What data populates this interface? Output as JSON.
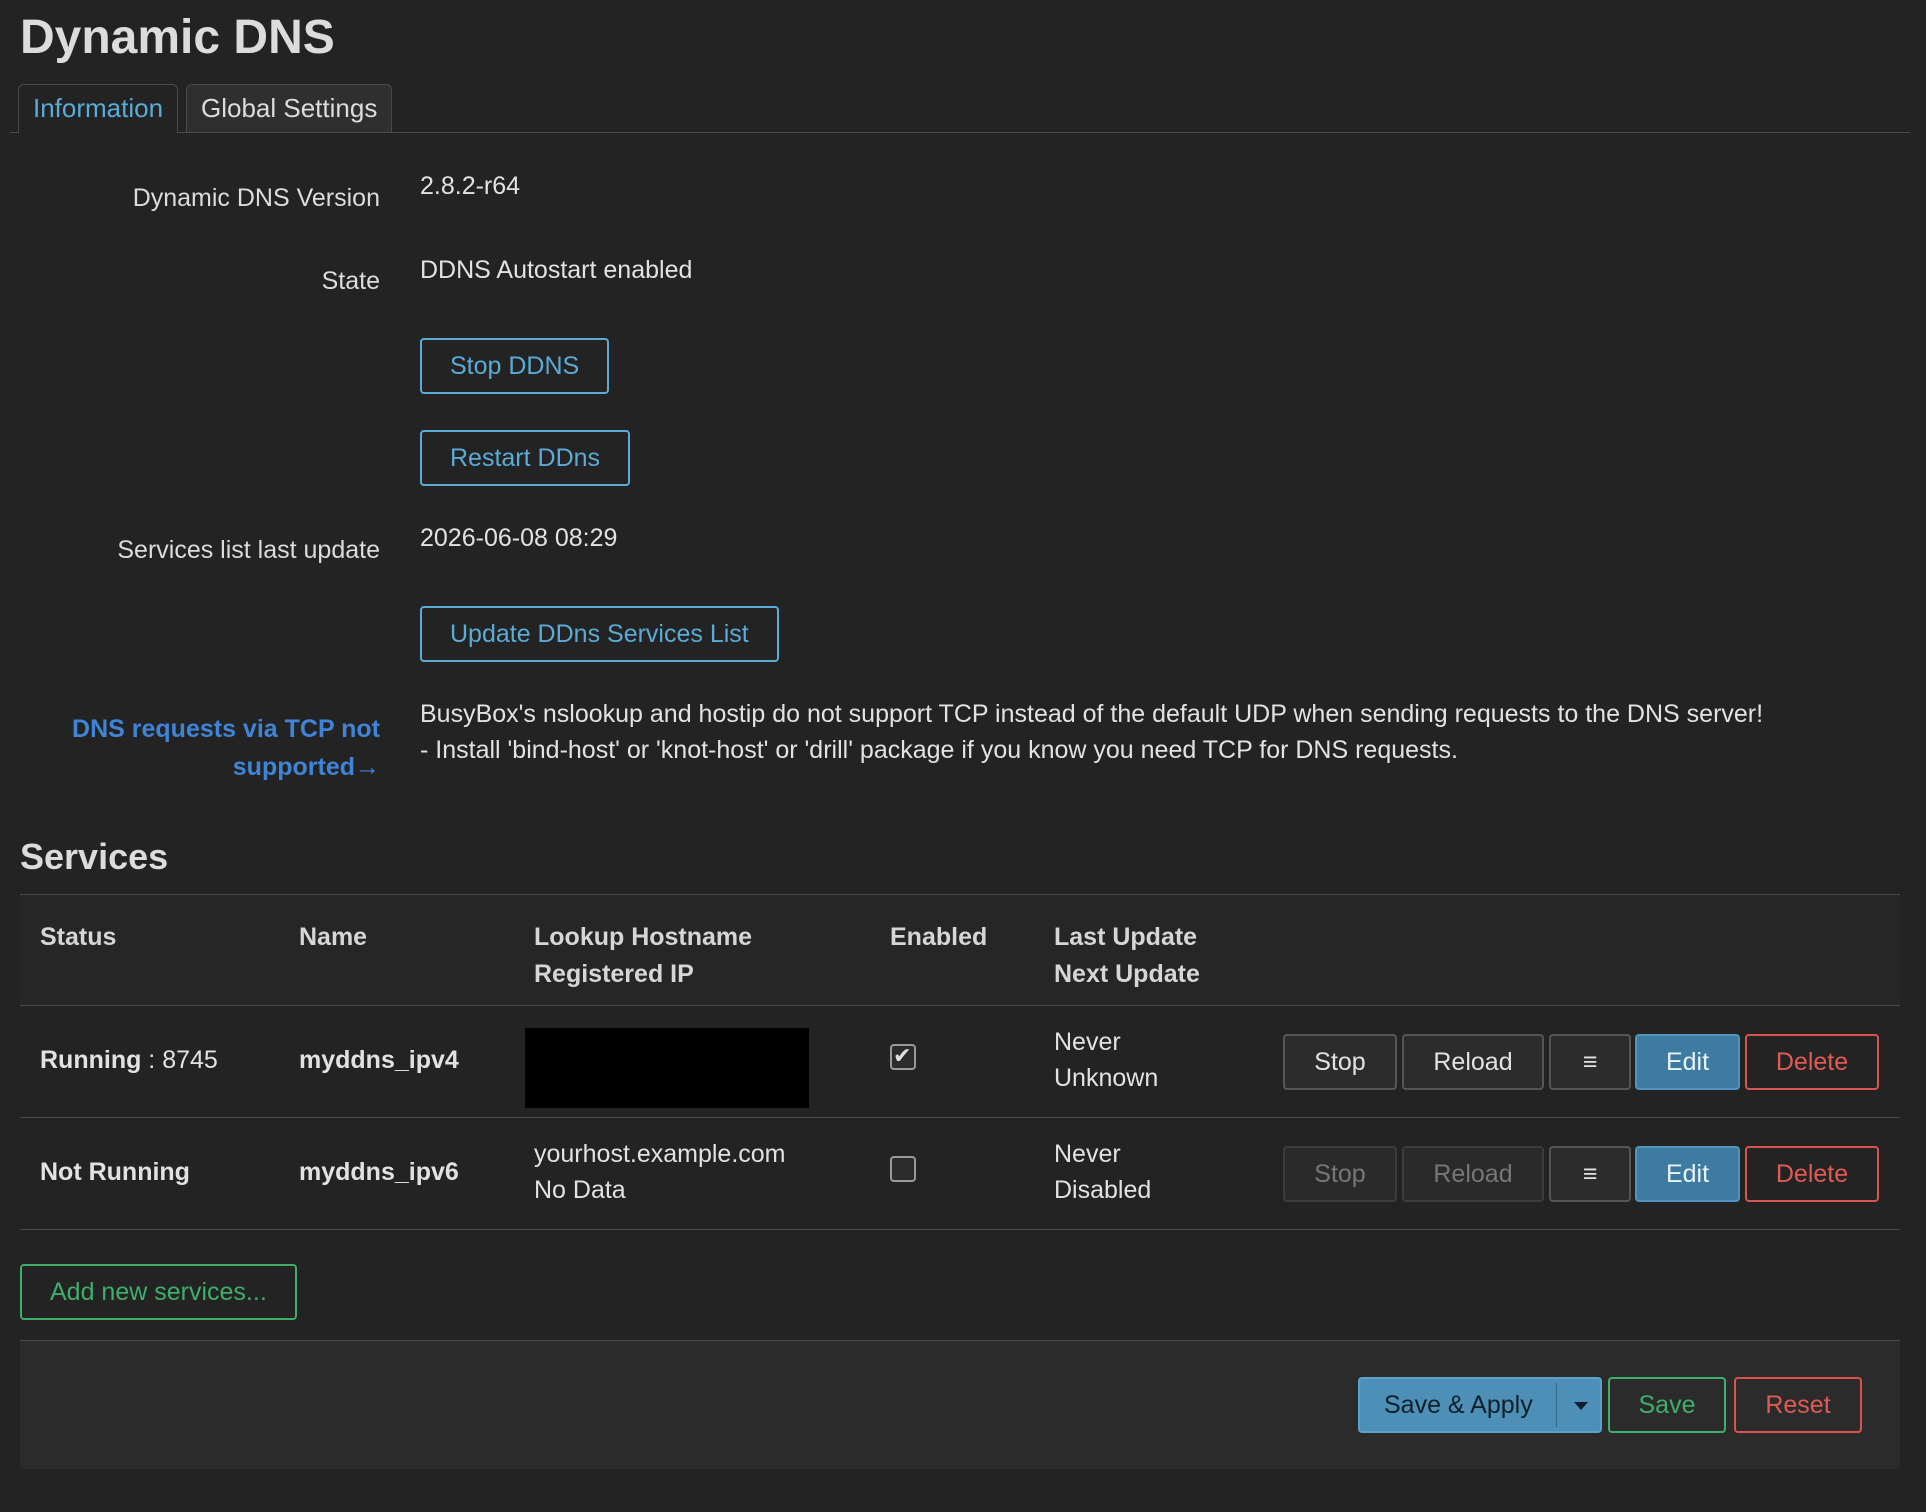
{
  "page": {
    "title": "Dynamic DNS"
  },
  "tabs": [
    {
      "label": "Information",
      "active": true
    },
    {
      "label": "Global Settings",
      "active": false
    }
  ],
  "info": {
    "version_label": "Dynamic DNS Version",
    "version_value": "2.8.2-r64",
    "state_label": "State",
    "state_value": "DDNS Autostart enabled",
    "stop_button": "Stop DDNS",
    "restart_button": "Restart DDns",
    "services_update_label": "Services list last update",
    "services_update_value": "2026-06-08 08:29",
    "update_services_button": "Update DDns Services List",
    "tcp_warning_label": "DNS requests via TCP not supported→",
    "tcp_warning_line1": "BusyBox's nslookup and hostip do not support TCP instead of the default UDP when sending requests to the DNS server!",
    "tcp_warning_line2": "- Install 'bind-host' or 'knot-host' or 'drill' package if you know you need TCP for DNS requests."
  },
  "services": {
    "title": "Services",
    "columns": {
      "status": "Status",
      "name": "Name",
      "lookup_line1": "Lookup Hostname",
      "lookup_line2": "Registered IP",
      "enabled": "Enabled",
      "update_line1": "Last Update",
      "update_line2": "Next Update"
    },
    "rows": [
      {
        "status": "Running",
        "status_suffix": " : 8745",
        "name": "myddns_ipv4",
        "lookup_hostname": "",
        "registered_ip": "",
        "enabled": true,
        "last_update": "Never",
        "next_update": "Unknown",
        "stop": "Stop",
        "reload": "Reload",
        "menu": "≡",
        "edit": "Edit",
        "delete": "Delete"
      },
      {
        "status": "Not Running",
        "status_suffix": "",
        "name": "myddns_ipv6",
        "lookup_hostname": "yourhost.example.com",
        "registered_ip": "No Data",
        "enabled": false,
        "last_update": "Never",
        "next_update": "Disabled",
        "stop": "Stop",
        "reload": "Reload",
        "menu": "≡",
        "edit": "Edit",
        "delete": "Delete"
      }
    ],
    "add_button": "Add new services..."
  },
  "footer": {
    "save_apply": "Save & Apply",
    "save": "Save",
    "reset": "Reset"
  },
  "colors": {
    "background": "#232323",
    "accent_blue": "#5aabd6",
    "link_blue": "#3f84d6",
    "success_green": "#3fae6a",
    "danger_red": "#d9534f"
  }
}
